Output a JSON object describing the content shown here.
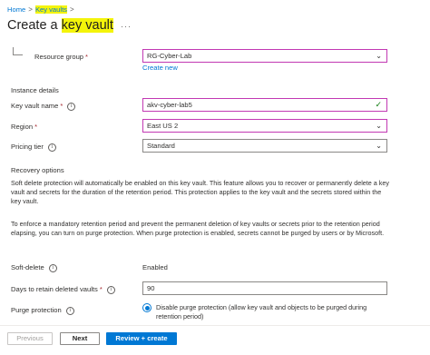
{
  "breadcrumb": {
    "home": "Home",
    "current": "Key vaults"
  },
  "header": {
    "title_prefix": "Create a ",
    "title_highlight": "key vault",
    "more": "···"
  },
  "resource_group": {
    "label": "Resource group",
    "required": "*",
    "value": "RG-Cyber-Lab",
    "create_new": "Create new"
  },
  "instance_details": {
    "heading": "Instance details",
    "key_vault_name": {
      "label": "Key vault name",
      "required": "*",
      "value": "akv-cyber-lab5"
    },
    "region": {
      "label": "Region",
      "required": "*",
      "value": "East US 2"
    },
    "pricing_tier": {
      "label": "Pricing tier",
      "value": "Standard"
    }
  },
  "recovery": {
    "heading": "Recovery options",
    "para1": "Soft delete protection will automatically be enabled on this key vault. This feature allows you to recover or permanently delete a key vault and secrets for the duration of the retention period. This protection applies to the key vault and the secrets stored within the key vault.",
    "para2": "To enforce a mandatory retention period and prevent the permanent deletion of key vaults or secrets prior to the retention period elapsing, you can turn on purge protection. When purge protection is enabled, secrets cannot be purged by users or by Microsoft.",
    "soft_delete": {
      "label": "Soft-delete",
      "value": "Enabled"
    },
    "retention": {
      "label": "Days to retain deleted vaults",
      "required": "*",
      "value": "90"
    },
    "purge": {
      "label": "Purge protection",
      "option": "Disable purge protection (allow key vault and objects to be purged during retention period)"
    }
  },
  "footer": {
    "previous": "Previous",
    "next": "Next",
    "review": "Review + create"
  },
  "colors": {
    "accent": "#0078d4",
    "highlight": "#f4f40a",
    "active_border": "#c239b3",
    "valid": "#107c10"
  }
}
